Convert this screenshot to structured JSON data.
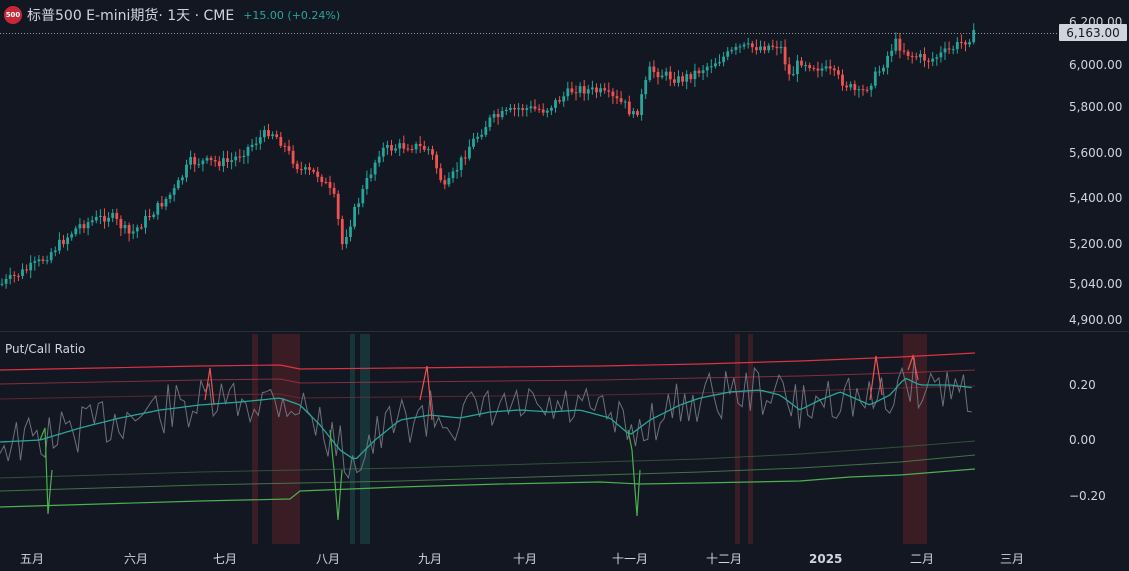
{
  "header": {
    "badge": "500",
    "title": "标普500 E-mini期货· 1天 · CME",
    "change": "+15.00 (+0.24%)"
  },
  "price_axis": {
    "labels": [
      "6,000.00",
      "5,800.00",
      "5,600.00",
      "5,400.00",
      "5,200.00",
      "5,040.00",
      "4,900.00"
    ],
    "top_partial": "6,200.00",
    "last_price": "6,163.00"
  },
  "indicator": {
    "title": "Put/Call Ratio",
    "axis_labels": [
      "0.20",
      "0.00",
      "−0.20"
    ]
  },
  "time_axis": {
    "labels": [
      "五月",
      "六月",
      "七月",
      "八月",
      "九月",
      "十月",
      "十一月",
      "十二月",
      "2025",
      "二月",
      "三月"
    ],
    "bold_label": "2025"
  },
  "colors": {
    "background": "#131722",
    "up": "#26a69a",
    "down": "#ef5350",
    "band_upper": "#f23645",
    "band_lower": "#4caf50",
    "highlight_red": "#4a1f28",
    "highlight_teal": "#163a3a"
  }
}
